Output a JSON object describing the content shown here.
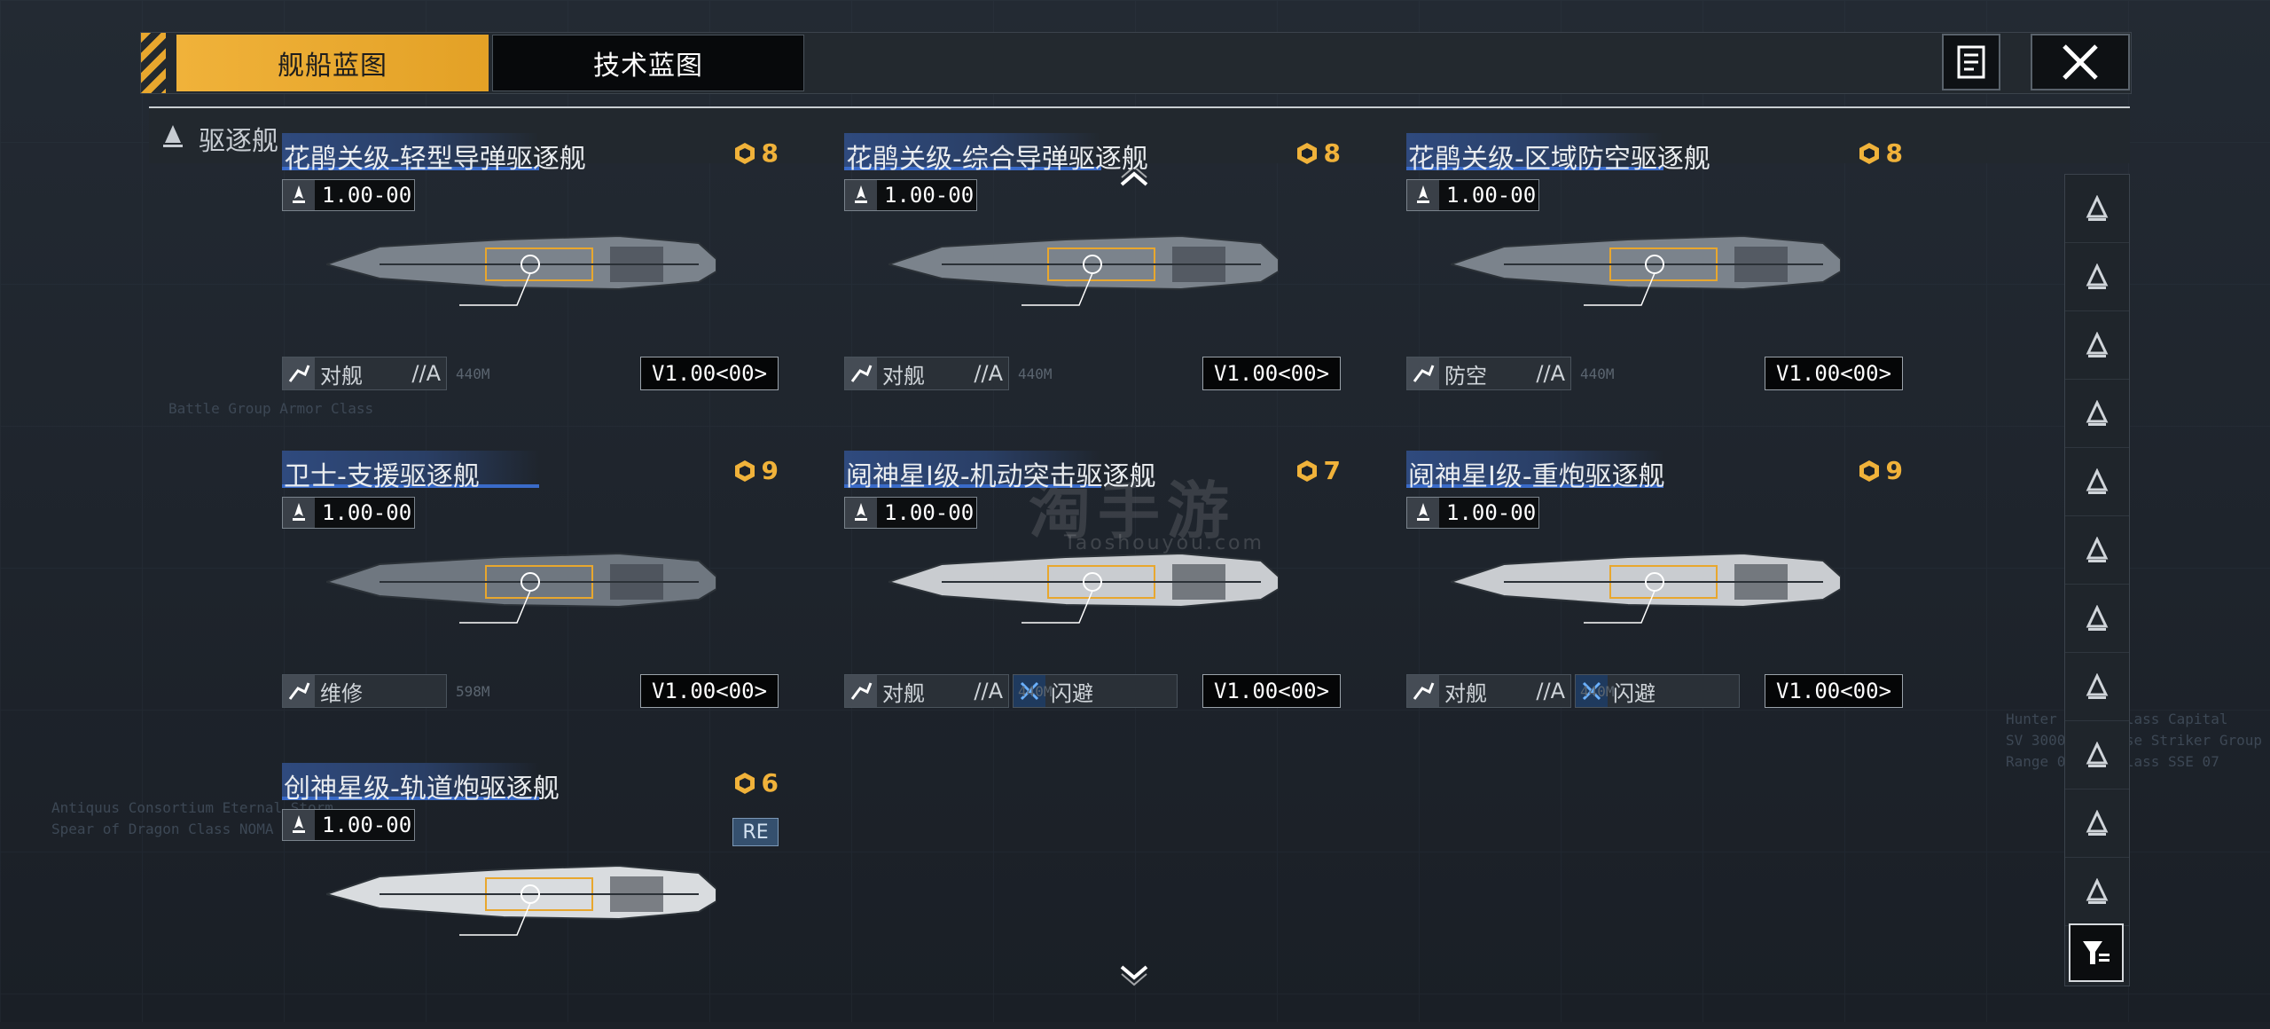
{
  "tabs": [
    {
      "label": "舰船蓝图",
      "active": true
    },
    {
      "label": "技术蓝图",
      "active": false
    }
  ],
  "category": {
    "label": "驱逐舰",
    "icon": "destroyer-class-icon"
  },
  "cards": [
    {
      "title": "花鹃关级-轻型导弹驱逐舰",
      "cost": "8",
      "level": "1.00-00",
      "role": "对舰",
      "grade": "//A",
      "role2": "",
      "version": "V1.00<00>",
      "ship_color": "#7b838c"
    },
    {
      "title": "花鹃关级-综合导弹驱逐舰",
      "cost": "8",
      "level": "1.00-00",
      "role": "对舰",
      "grade": "//A",
      "role2": "",
      "version": "V1.00<00>",
      "ship_color": "#7b838c"
    },
    {
      "title": "花鹃关级-区域防空驱逐舰",
      "cost": "8",
      "level": "1.00-00",
      "role": "防空",
      "grade": "//A",
      "role2": "",
      "version": "V1.00<00>",
      "ship_color": "#7b838c"
    },
    {
      "title": "卫士-支援驱逐舰",
      "cost": "9",
      "level": "1.00-00",
      "role": "维修",
      "grade": "",
      "role2": "",
      "version": "V1.00<00>",
      "ship_color": "#6f7780"
    },
    {
      "title": "阋神星I级-机动突击驱逐舰",
      "cost": "7",
      "level": "1.00-00",
      "role": "对舰",
      "grade": "//A",
      "role2": "闪避",
      "version": "V1.00<00>",
      "ship_color": "#c9ccd0"
    },
    {
      "title": "阋神星I级-重炮驱逐舰",
      "cost": "9",
      "level": "1.00-00",
      "role": "对舰",
      "grade": "//A",
      "role2": "闪避",
      "version": "V1.00<00>",
      "ship_color": "#c9ccd0"
    },
    {
      "title": "创神星级-轨道炮驱逐舰",
      "cost": "6",
      "level": "1.00-00",
      "role": "",
      "grade": "",
      "role2": "",
      "version": "",
      "tag": "RE",
      "ship_color": "#d9dcdf"
    }
  ],
  "scale_label": "440M",
  "scale_label_2": "598M",
  "watermark": "淘手游",
  "watermark_sub": "Taoshouyou.com",
  "rail_icons": [
    "fleet-all-icon",
    "carrier-icon",
    "battleship-icon",
    "cruiser-icon",
    "destroyer-icon",
    "frigate-icon",
    "corvette-icon",
    "fighter-icon",
    "aux-icon",
    "station-icon",
    "misc-icon"
  ],
  "bg_text": [
    "Battle Group Armor Class",
    "Antiquus Consortium Eternal Storm",
    "Spear of Dragon Class NOMA Ship",
    "Hunter Swept Class Capital",
    "SV 30000 Defense Striker Group",
    "Range 0000 B Class SSE 07"
  ],
  "colors": {
    "accent": "#f0b23a",
    "title_bar": "#2f4a7e",
    "bg": "#1c2128"
  }
}
